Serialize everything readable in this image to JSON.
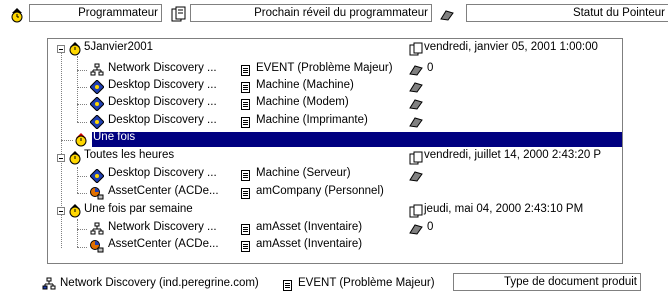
{
  "header": {
    "col1": "Programmateur",
    "col2": "Prochain réveil du programmateur",
    "col3": "Statut du Pointeur"
  },
  "tree": [
    {
      "label": "5Janvier2001",
      "date": "vendredi, janvier 05, 2001 1:00:00"
    },
    {
      "app": "Network Discovery ...",
      "event": "EVENT (Problème Majeur)",
      "status": "0"
    },
    {
      "app": "Desktop Discovery ...",
      "event": "Machine (Machine)"
    },
    {
      "app": "Desktop Discovery ...",
      "event": "Machine (Modem)"
    },
    {
      "app": "Desktop Discovery ...",
      "event": "Machine (Imprimante)"
    },
    {
      "label": "Une fois"
    },
    {
      "label": "Toutes les heures",
      "date": "vendredi, juillet 14, 2000 2:43:20 P"
    },
    {
      "app": "Desktop Discovery ...",
      "event": "Machine (Serveur)"
    },
    {
      "app": "AssetCenter (ACDe...",
      "event": "amCompany (Personnel)"
    },
    {
      "label": "Une fois par semaine",
      "date": "jeudi, mai 04, 2000 2:43:10 PM"
    },
    {
      "app": "Network Discovery ...",
      "event": "amAsset (Inventaire)",
      "status": "0"
    },
    {
      "app": "AssetCenter (ACDe...",
      "event": "amAsset (Inventaire)"
    }
  ],
  "footer": {
    "app": "Network Discovery (ind.peregrine.com)",
    "event": "EVENT (Problème Majeur)",
    "doc_type": "Type de document produit"
  }
}
